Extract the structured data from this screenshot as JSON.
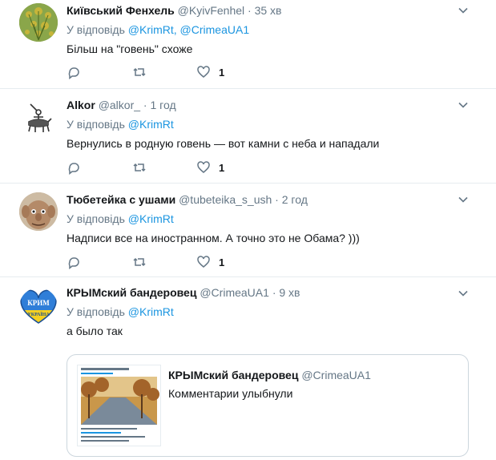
{
  "tweets": [
    {
      "name": "Київський Фенхель",
      "handle": "@KyivFenhel",
      "time": "35 хв",
      "reply_prefix": "У відповідь",
      "reply_to": "@KrimRt, @CrimeaUA1",
      "text": "Більш на \"говень\" схоже",
      "likes": "1"
    },
    {
      "name": "Alkor",
      "handle": "@alkor_",
      "time": "1 год",
      "reply_prefix": "У відповідь",
      "reply_to": "@KrimRt",
      "text": "Вернулись в родную говень — вот камни с неба и нападали",
      "likes": "1"
    },
    {
      "name": "Тюбетейка с ушами",
      "handle": "@tubeteika_s_ush",
      "time": "2 год",
      "reply_prefix": "У відповідь",
      "reply_to": "@KrimRt",
      "text": "Надписи все на иностранном. А точно это не Обама? )))",
      "likes": "1"
    },
    {
      "name": "КРЫМский бандеровец",
      "handle": "@CrimeaUA1",
      "time": "9 хв",
      "reply_prefix": "У відповідь",
      "reply_to": "@KrimRt",
      "text": "а было так",
      "avatar_text_1": "КРИМ",
      "avatar_text_2": "УКРАЇНА"
    }
  ],
  "quote": {
    "name": "КРЫМский бандеровец",
    "handle": "@CrimeaUA1",
    "text": "Комментарии улыбнули"
  },
  "separator": "·",
  "colors": {
    "link": "#1b95e0",
    "muted": "#657786",
    "border": "#e6ecf0"
  }
}
